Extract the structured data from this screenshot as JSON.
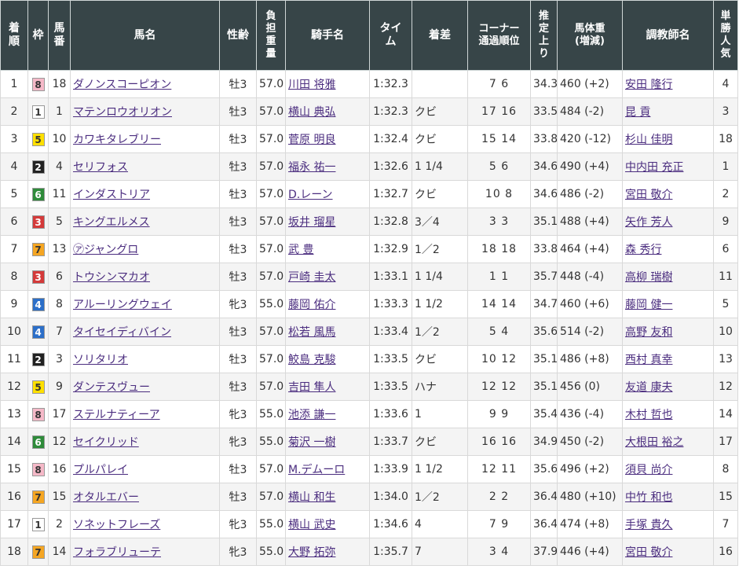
{
  "headers": {
    "rank": "着順",
    "waku": "枠",
    "umaban": "馬番",
    "horse": "馬名",
    "sexage": "性齢",
    "weight": "負担重量",
    "jockey": "騎手名",
    "time": "タイム",
    "margin": "着差",
    "corner": "コーナー通過順位",
    "last3f": "推定上り",
    "bodyweight": "馬体重(増減)",
    "trainer": "調教師名",
    "popularity": "単勝人気"
  },
  "header_lines": {
    "rank": [
      "着",
      "順"
    ],
    "waku": [
      "枠"
    ],
    "umaban": [
      "馬",
      "番"
    ],
    "horse": [
      "馬名"
    ],
    "sexage": [
      "性齢"
    ],
    "weight": [
      "負",
      "担",
      "重",
      "量"
    ],
    "jockey": [
      "騎手名"
    ],
    "time": [
      "タイ",
      "ム"
    ],
    "margin": [
      "着差"
    ],
    "corner": [
      "コーナー",
      "通過順位"
    ],
    "last3f": [
      "推",
      "定",
      "上",
      "り"
    ],
    "bodyweight": [
      "馬体重",
      "(増減)"
    ],
    "trainer": [
      "調教師名"
    ],
    "popularity": [
      "単",
      "勝",
      "人",
      "気"
    ]
  },
  "waku_colors": {
    "1": {
      "bg": "#ffffff",
      "fg": "#333333"
    },
    "2": {
      "bg": "#222222",
      "fg": "#ffffff"
    },
    "3": {
      "bg": "#d43a3a",
      "fg": "#ffffff"
    },
    "4": {
      "bg": "#2c6fc9",
      "fg": "#ffffff"
    },
    "5": {
      "bg": "#ffe000",
      "fg": "#333333"
    },
    "6": {
      "bg": "#2e8b3a",
      "fg": "#ffffff"
    },
    "7": {
      "bg": "#f5a623",
      "fg": "#333333"
    },
    "8": {
      "bg": "#f5b9c8",
      "fg": "#333333"
    }
  },
  "rows": [
    {
      "rank": "1",
      "waku": "8",
      "umaban": "18",
      "horse": "ダノンスコーピオン",
      "sexage": "牡3",
      "weight": "57.0",
      "jockey": "川田 将雅",
      "time": "1:32.3",
      "margin": "",
      "corner": "7 6",
      "last3f": "34.3",
      "bodyweight": "460 (+2)",
      "trainer": "安田 隆行",
      "popularity": "4"
    },
    {
      "rank": "2",
      "waku": "1",
      "umaban": "1",
      "horse": "マテンロウオリオン",
      "sexage": "牡3",
      "weight": "57.0",
      "jockey": "横山 典弘",
      "time": "1:32.3",
      "margin": "クビ",
      "corner": "17 16",
      "last3f": "33.5",
      "bodyweight": "484 (-2)",
      "trainer": "昆 貢",
      "popularity": "3"
    },
    {
      "rank": "3",
      "waku": "5",
      "umaban": "10",
      "horse": "カワキタレブリー",
      "sexage": "牡3",
      "weight": "57.0",
      "jockey": "菅原 明良",
      "time": "1:32.4",
      "margin": "クビ",
      "corner": "15 14",
      "last3f": "33.8",
      "bodyweight": "420 (-12)",
      "trainer": "杉山 佳明",
      "popularity": "18"
    },
    {
      "rank": "4",
      "waku": "2",
      "umaban": "4",
      "horse": "セリフォス",
      "sexage": "牡3",
      "weight": "57.0",
      "jockey": "福永 祐一",
      "time": "1:32.6",
      "margin": "1 1/4",
      "corner": "5 6",
      "last3f": "34.6",
      "bodyweight": "490 (+4)",
      "trainer": "中内田 充正",
      "popularity": "1"
    },
    {
      "rank": "5",
      "waku": "6",
      "umaban": "11",
      "horse": "インダストリア",
      "sexage": "牡3",
      "weight": "57.0",
      "jockey": "D.レーン",
      "time": "1:32.7",
      "margin": "クビ",
      "corner": "10 8",
      "last3f": "34.6",
      "bodyweight": "486 (-2)",
      "trainer": "宮田 敬介",
      "popularity": "2"
    },
    {
      "rank": "6",
      "waku": "3",
      "umaban": "5",
      "horse": "キングエルメス",
      "sexage": "牡3",
      "weight": "57.0",
      "jockey": "坂井 瑠星",
      "time": "1:32.8",
      "margin": "3／4",
      "corner": "3 3",
      "last3f": "35.1",
      "bodyweight": "488 (+4)",
      "trainer": "矢作 芳人",
      "popularity": "9"
    },
    {
      "rank": "7",
      "waku": "7",
      "umaban": "13",
      "horse": "㋐ジャングロ",
      "sexage": "牡3",
      "weight": "57.0",
      "jockey": "武 豊",
      "time": "1:32.9",
      "margin": "1／2",
      "corner": "18 18",
      "last3f": "33.8",
      "bodyweight": "464 (+4)",
      "trainer": "森 秀行",
      "popularity": "6"
    },
    {
      "rank": "8",
      "waku": "3",
      "umaban": "6",
      "horse": "トウシンマカオ",
      "sexage": "牡3",
      "weight": "57.0",
      "jockey": "戸崎 圭太",
      "time": "1:33.1",
      "margin": "1 1/4",
      "corner": "1 1",
      "last3f": "35.7",
      "bodyweight": "448 (-4)",
      "trainer": "高柳 瑞樹",
      "popularity": "11"
    },
    {
      "rank": "9",
      "waku": "4",
      "umaban": "8",
      "horse": "アルーリングウェイ",
      "sexage": "牝3",
      "weight": "55.0",
      "jockey": "藤岡 佑介",
      "time": "1:33.3",
      "margin": "1 1/2",
      "corner": "14 14",
      "last3f": "34.7",
      "bodyweight": "460 (+6)",
      "trainer": "藤岡 健一",
      "popularity": "5"
    },
    {
      "rank": "10",
      "waku": "4",
      "umaban": "7",
      "horse": "タイセイディバイン",
      "sexage": "牡3",
      "weight": "57.0",
      "jockey": "松若 風馬",
      "time": "1:33.4",
      "margin": "1／2",
      "corner": "5 4",
      "last3f": "35.6",
      "bodyweight": "514 (-2)",
      "trainer": "高野 友和",
      "popularity": "10"
    },
    {
      "rank": "11",
      "waku": "2",
      "umaban": "3",
      "horse": "ソリタリオ",
      "sexage": "牡3",
      "weight": "57.0",
      "jockey": "鮫島 克駿",
      "time": "1:33.5",
      "margin": "クビ",
      "corner": "10 12",
      "last3f": "35.1",
      "bodyweight": "486 (+8)",
      "trainer": "西村 真幸",
      "popularity": "13"
    },
    {
      "rank": "12",
      "waku": "5",
      "umaban": "9",
      "horse": "ダンテスヴュー",
      "sexage": "牡3",
      "weight": "57.0",
      "jockey": "吉田 隼人",
      "time": "1:33.5",
      "margin": "ハナ",
      "corner": "12 12",
      "last3f": "35.1",
      "bodyweight": "456 (0)",
      "trainer": "友道 康夫",
      "popularity": "12"
    },
    {
      "rank": "13",
      "waku": "8",
      "umaban": "17",
      "horse": "ステルナティーア",
      "sexage": "牝3",
      "weight": "55.0",
      "jockey": "池添 謙一",
      "time": "1:33.6",
      "margin": "1",
      "corner": "9 9",
      "last3f": "35.4",
      "bodyweight": "436 (-4)",
      "trainer": "木村 哲也",
      "popularity": "14"
    },
    {
      "rank": "14",
      "waku": "6",
      "umaban": "12",
      "horse": "セイクリッド",
      "sexage": "牝3",
      "weight": "55.0",
      "jockey": "菊沢 一樹",
      "time": "1:33.7",
      "margin": "クビ",
      "corner": "16 16",
      "last3f": "34.9",
      "bodyweight": "450 (-2)",
      "trainer": "大根田 裕之",
      "popularity": "17"
    },
    {
      "rank": "15",
      "waku": "8",
      "umaban": "16",
      "horse": "プルパレイ",
      "sexage": "牡3",
      "weight": "57.0",
      "jockey": "M.デムーロ",
      "time": "1:33.9",
      "margin": "1 1/2",
      "corner": "12 11",
      "last3f": "35.6",
      "bodyweight": "496 (+2)",
      "trainer": "須貝 尚介",
      "popularity": "8"
    },
    {
      "rank": "16",
      "waku": "7",
      "umaban": "15",
      "horse": "オタルエバー",
      "sexage": "牡3",
      "weight": "57.0",
      "jockey": "横山 和生",
      "time": "1:34.0",
      "margin": "1／2",
      "corner": "2 2",
      "last3f": "36.4",
      "bodyweight": "480 (+10)",
      "trainer": "中竹 和也",
      "popularity": "15"
    },
    {
      "rank": "17",
      "waku": "1",
      "umaban": "2",
      "horse": "ソネットフレーズ",
      "sexage": "牝3",
      "weight": "55.0",
      "jockey": "横山 武史",
      "time": "1:34.6",
      "margin": "4",
      "corner": "7 9",
      "last3f": "36.4",
      "bodyweight": "474 (+8)",
      "trainer": "手塚 貴久",
      "popularity": "7"
    },
    {
      "rank": "18",
      "waku": "7",
      "umaban": "14",
      "horse": "フォラブリューテ",
      "sexage": "牝3",
      "weight": "55.0",
      "jockey": "大野 拓弥",
      "time": "1:35.7",
      "margin": "7",
      "corner": "3 4",
      "last3f": "37.9",
      "bodyweight": "446 (+4)",
      "trainer": "宮田 敬介",
      "popularity": "16"
    }
  ]
}
